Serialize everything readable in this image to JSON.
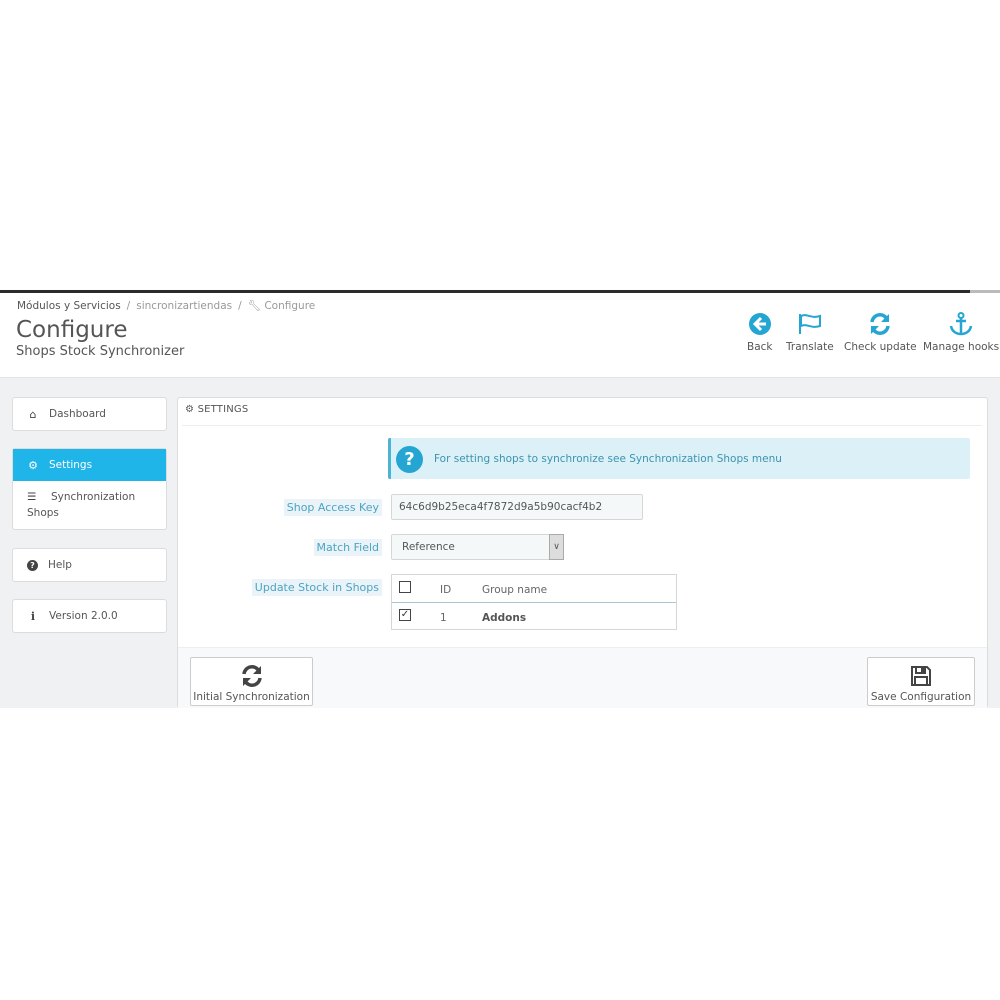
{
  "breadcrumb": [
    "Módulos y Servicios",
    "sincronizartiendas",
    "Configure"
  ],
  "header": {
    "title": "Configure",
    "subtitle": "Shops Stock Synchronizer"
  },
  "toolbar": [
    {
      "label": "Back",
      "icon": "arrow-left-circle-icon"
    },
    {
      "label": "Translate",
      "icon": "flag-icon"
    },
    {
      "label": "Check update",
      "icon": "refresh-icon"
    },
    {
      "label": "Manage hooks",
      "icon": "anchor-icon"
    }
  ],
  "sidebar": {
    "dashboard": "Dashboard",
    "settings": "Settings",
    "sync_shops": "Synchronization Shops",
    "help": "Help",
    "version": "Version 2.0.0"
  },
  "panel": {
    "title": "SETTINGS",
    "alert": "For setting shops to synchronize see Synchronization Shops menu",
    "shop_access_key_label": "Shop Access Key",
    "shop_access_key_value": "64c6d9b25eca4f7872d9a5b90cacf4b2",
    "match_field_label": "Match Field",
    "match_field_value": "Reference",
    "update_stock_label": "Update Stock in Shops",
    "table": {
      "headers": {
        "id": "ID",
        "name": "Group name"
      },
      "rows": [
        {
          "checked": true,
          "id": "1",
          "name": "Addons"
        }
      ]
    },
    "initial_sync": "Initial Synchronization",
    "save": "Save Configuration"
  },
  "colors": {
    "accent": "#1fb5e9",
    "icon": "#25a6d2",
    "alert_bg": "#dcf1f7"
  }
}
